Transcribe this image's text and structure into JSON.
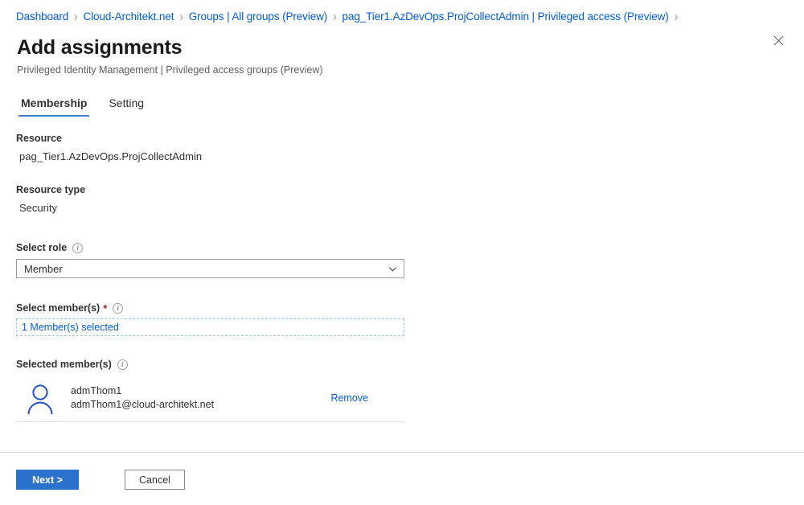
{
  "breadcrumb": {
    "items": [
      "Dashboard",
      "Cloud-Architekt.net",
      "Groups | All groups (Preview)",
      "pag_Tier1.AzDevOps.ProjCollectAdmin | Privileged access (Preview)"
    ],
    "separator": "›"
  },
  "header": {
    "title": "Add assignments",
    "subtitle": "Privileged Identity Management | Privileged access groups (Preview)",
    "close_label": "✕"
  },
  "tabs": [
    {
      "label": "Membership",
      "active": true
    },
    {
      "label": "Setting",
      "active": false
    }
  ],
  "form": {
    "resource": {
      "label": "Resource",
      "value": "pag_Tier1.AzDevOps.ProjCollectAdmin"
    },
    "resource_type": {
      "label": "Resource type",
      "value": "Security"
    },
    "select_role": {
      "label": "Select role",
      "info": "i",
      "value": "Member"
    },
    "select_members": {
      "label": "Select member(s)",
      "required_mark": "*",
      "info": "i",
      "value": "1 Member(s) selected"
    },
    "selected_members": {
      "label": "Selected member(s)",
      "info": "i",
      "rows": [
        {
          "name": "admThom1",
          "email": "admThom1@cloud-architekt.net",
          "action_label": "Remove"
        }
      ]
    }
  },
  "footer": {
    "next_label": "Next >",
    "cancel_label": "Cancel"
  },
  "colors": {
    "link": "#015cda",
    "primary": "#2a72cc",
    "required": "#a4262c",
    "tab_underline": "#4a7fd0",
    "avatar": "#1f4fd8"
  }
}
